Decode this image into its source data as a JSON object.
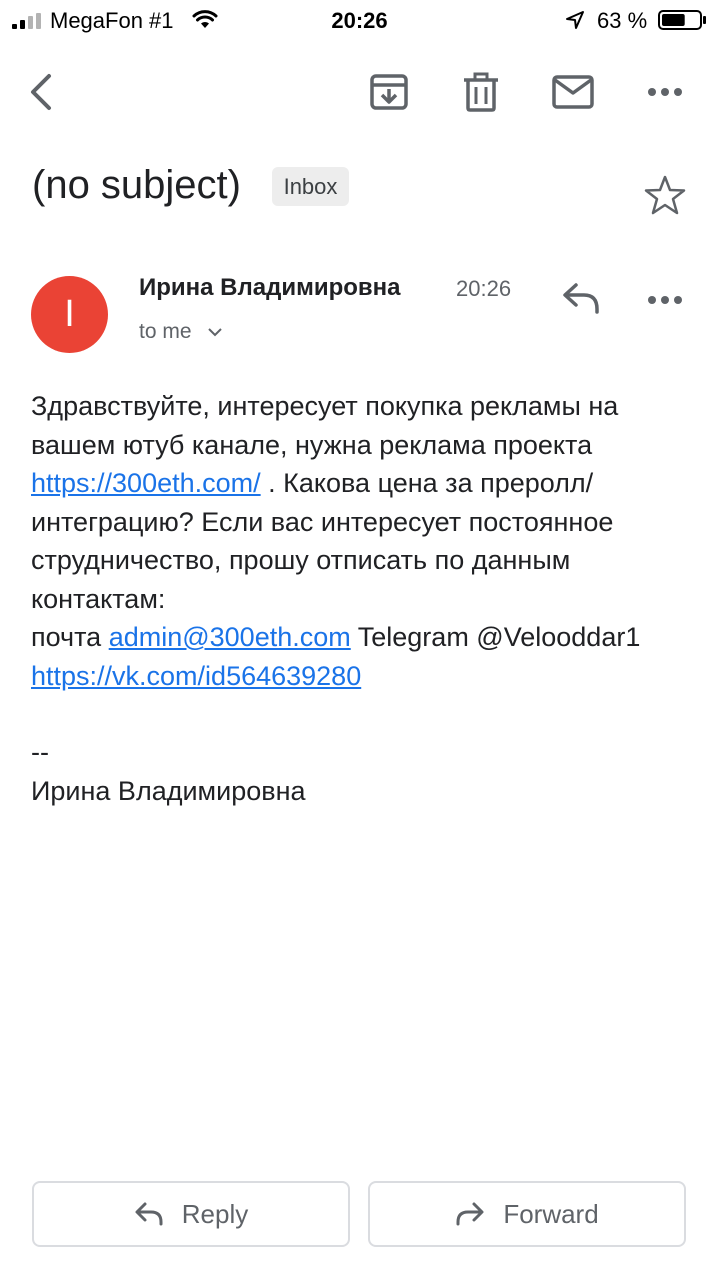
{
  "status_bar": {
    "carrier": "MegaFon #1",
    "time": "20:26",
    "battery_text": "63 %",
    "battery_level": 0.63
  },
  "toolbar": {
    "icons": [
      "back-icon",
      "archive-icon",
      "trash-icon",
      "mail-icon",
      "more-icon"
    ]
  },
  "email": {
    "subject": "(no subject)",
    "label": "Inbox",
    "sender": {
      "initial": "I",
      "name": "Ирина Владимировна",
      "time": "20:26",
      "recipient": "to me",
      "avatar_color": "#ea4335"
    },
    "body": {
      "t1": "Здравствуйте, интересует покупка рекламы на вашем ютуб канале, нужна реклама проекта ",
      "link1": "https://300eth.com/",
      "t2": " . Какова цена за преролл/интеграцию? Если вас интересует постоянное струдничество, прошу отписать по данным контактам:",
      "t3": "почта ",
      "link2": "admin@300eth.com",
      "t4": " Telegram @Velooddar1 ",
      "link3": "https://vk.com/id564639280"
    },
    "signature_sep": "--",
    "signature_name": "Ирина Владимировна"
  },
  "actions": {
    "reply_label": "Reply",
    "forward_label": "Forward"
  },
  "colors": {
    "link": "#1a73e8",
    "icon": "#5f6368"
  }
}
